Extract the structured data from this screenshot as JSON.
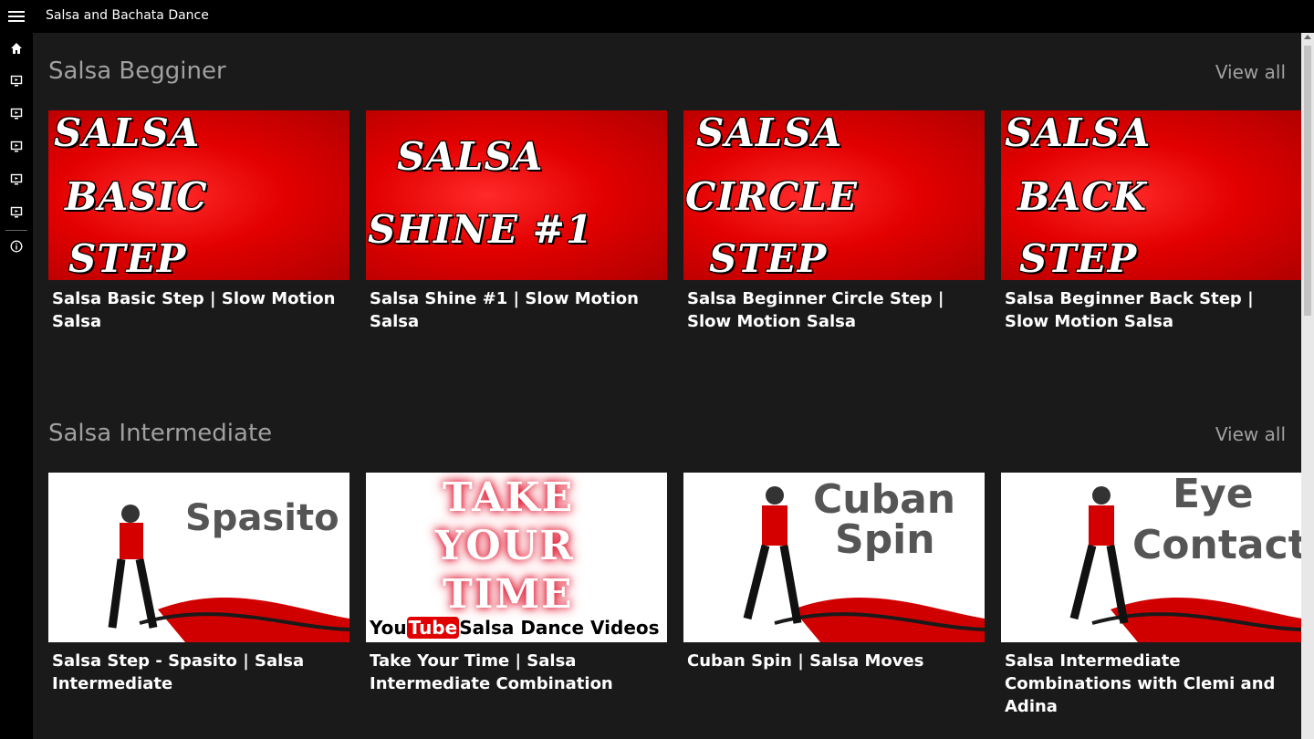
{
  "app": {
    "title": "Salsa and Bachata Dance"
  },
  "sidebar": {
    "items": [
      {
        "icon": "home-icon"
      },
      {
        "icon": "monitor-icon"
      },
      {
        "icon": "monitor-icon"
      },
      {
        "icon": "monitor-icon"
      },
      {
        "icon": "monitor-icon"
      },
      {
        "icon": "monitor-icon"
      },
      {
        "icon": "info-icon"
      }
    ]
  },
  "sections": [
    {
      "title": "Salsa Begginer",
      "view_all": "View all",
      "videos": [
        {
          "thumb_lines": [
            "SALSA",
            "BASIC",
            "STEP"
          ],
          "caption": "Salsa Basic Step | Slow Motion Salsa"
        },
        {
          "thumb_lines": [
            "SALSA",
            "SHINE #1"
          ],
          "caption": "Salsa Shine #1 | Slow Motion Salsa"
        },
        {
          "thumb_lines": [
            "SALSA",
            "CIRCLE",
            "STEP"
          ],
          "caption": "Salsa Beginner Circle Step | Slow Motion Salsa"
        },
        {
          "thumb_lines": [
            "SALSA",
            "BACK",
            "STEP"
          ],
          "caption": "Salsa Beginner Back Step | Slow Motion Salsa"
        }
      ]
    },
    {
      "title": "Salsa Intermediate",
      "view_all": "View all",
      "videos": [
        {
          "thumb_lines": [
            "Spasito"
          ],
          "caption": "Salsa Step - Spasito | Salsa Intermediate"
        },
        {
          "thumb_lines": [
            "TAKE",
            "YOUR",
            "TIME"
          ],
          "thumb_footer_you": "You",
          "thumb_footer_tube": "Tube",
          "thumb_footer_rest": "Salsa Dance Videos",
          "caption": "Take Your Time | Salsa Intermediate Combination"
        },
        {
          "thumb_lines": [
            "Cuban",
            "Spin"
          ],
          "caption": "Cuban Spin | Salsa Moves"
        },
        {
          "thumb_lines": [
            "Eye",
            "Contact"
          ],
          "caption": "Salsa Intermediate Combinations with Clemi and Adina"
        }
      ]
    }
  ],
  "colors": {
    "background": "#1a1a1a",
    "titlebar": "#000000",
    "thumb_red": "#e30000",
    "section_text": "#a0a0a0"
  }
}
